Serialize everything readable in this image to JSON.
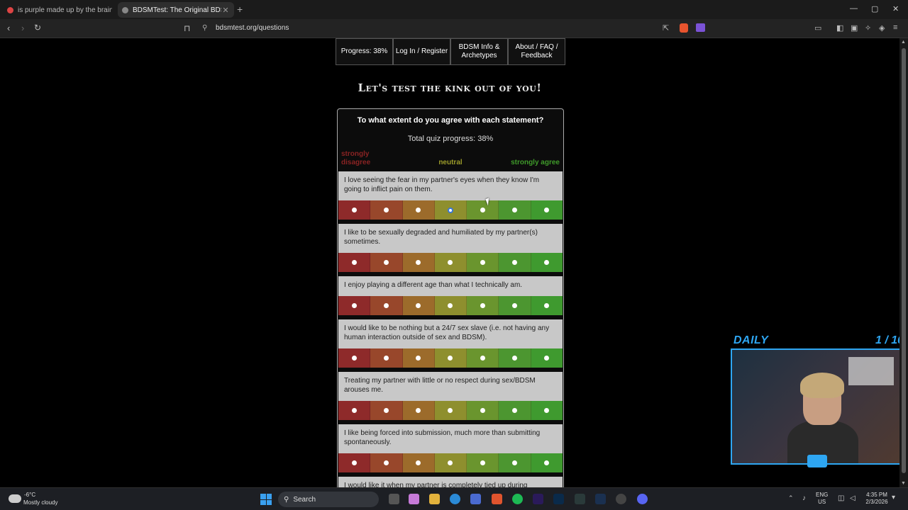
{
  "browser": {
    "tabs": [
      {
        "title": "is purple made up by the brain - Brav",
        "active": false
      },
      {
        "title": "BDSMTest: The Original BDSM & ",
        "active": true
      }
    ],
    "new_tab": "+",
    "url": "bdsmtest.org/questions",
    "window_controls": {
      "minimize": "—",
      "restore": "▢",
      "close": "✕"
    }
  },
  "nav": {
    "progress": "Progress: 38%",
    "login": "Log In / Register",
    "info": "BDSM Info & Archetypes",
    "about": "About / FAQ / Feedback"
  },
  "heading": "Let's test the kink out of you!",
  "quiz": {
    "title": "To what extent do you agree with each statement?",
    "progress": "Total quiz progress: 38%",
    "scale_labels": {
      "left": "strongly disagree",
      "middle": "neutral",
      "right": "strongly agree"
    },
    "scale_colors": [
      "#8e2a2a",
      "#98472b",
      "#9c6b2b",
      "#8e8f2e",
      "#6a952e",
      "#4c9630",
      "#3f9a2f"
    ],
    "questions": [
      {
        "text": "I love seeing the fear in my partner's eyes when they know I'm going to inflict pain on them.",
        "selected": 3
      },
      {
        "text": "I like to be sexually degraded and humiliated by my partner(s) sometimes.",
        "selected": -1
      },
      {
        "text": "I enjoy playing a different age than what I technically am.",
        "selected": -1
      },
      {
        "text": "I would like to be nothing but a 24/7 sex slave (i.e. not having any human interaction outside of sex and BDSM).",
        "selected": -1
      },
      {
        "text": "Treating my partner with little or no respect during sex/BDSM arouses me.",
        "selected": -1
      },
      {
        "text": "I like being forced into submission, much more than submitting spontaneously.",
        "selected": -1
      },
      {
        "text": "I would like it when my partner is completely tied up during",
        "selected": -1
      }
    ]
  },
  "stream_overlay": {
    "daily": "DAILY",
    "count": "1 / 10"
  },
  "taskbar": {
    "weather_temp": "-6°C",
    "weather_cond": "Mostly cloudy",
    "search": "Search",
    "lang": "ENG",
    "region": "US",
    "time": "4:35 PM",
    "date": "2/3/2026"
  }
}
